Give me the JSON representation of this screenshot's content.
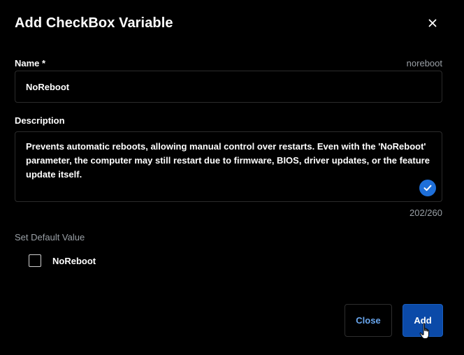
{
  "dialog": {
    "title": "Add CheckBox Variable",
    "close_icon": "close-icon"
  },
  "name_field": {
    "label": "Name *",
    "hint": "noreboot",
    "value": "NoReboot"
  },
  "description_field": {
    "label": "Description",
    "value": "Prevents automatic reboots, allowing manual control over restarts. Even with the 'NoReboot' parameter, the computer may still restart due to firmware, BIOS, driver updates, or the feature update itself.",
    "status_icon": "check-circle-icon",
    "counter": "202/260"
  },
  "default_value": {
    "section_label": "Set Default Value",
    "checkbox_label": "NoReboot",
    "checked": false
  },
  "buttons": {
    "close_label": "Close",
    "add_label": "Add"
  },
  "colors": {
    "background": "#000000",
    "accent": "#1e6fd9",
    "primary_button": "#0b4aa8",
    "link_text": "#6aa8f0",
    "muted_text": "#9aa0a6"
  },
  "cursor_icon": "hand-pointer-icon"
}
